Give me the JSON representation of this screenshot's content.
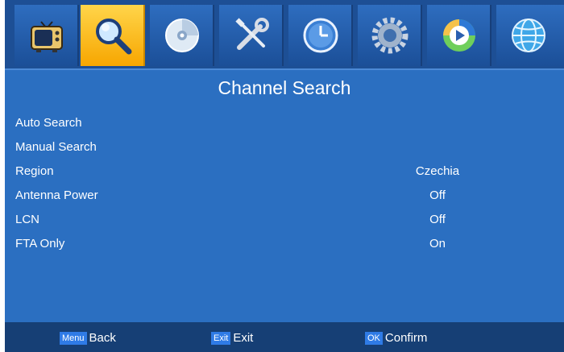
{
  "menu_tabs": [
    {
      "icon": "tv-icon",
      "active": false
    },
    {
      "icon": "search-icon",
      "active": true
    },
    {
      "icon": "disc-icon",
      "active": false
    },
    {
      "icon": "tools-icon",
      "active": false
    },
    {
      "icon": "clock-icon",
      "active": false
    },
    {
      "icon": "gear-icon",
      "active": false
    },
    {
      "icon": "media-player-icon",
      "active": false
    },
    {
      "icon": "globe-icon",
      "active": false
    }
  ],
  "page": {
    "title": "Channel Search"
  },
  "items": [
    {
      "label": "Auto Search",
      "value": ""
    },
    {
      "label": "Manual Search",
      "value": ""
    },
    {
      "label": "Region",
      "value": "Czechia"
    },
    {
      "label": "Antenna Power",
      "value": "Off"
    },
    {
      "label": "LCN",
      "value": "Off"
    },
    {
      "label": "FTA Only",
      "value": "On"
    }
  ],
  "footer": {
    "back_key": "Menu",
    "back_label": "Back",
    "exit_key": "Exit",
    "exit_label": "Exit",
    "ok_key": "OK",
    "ok_label": "Confirm"
  },
  "colors": {
    "background": "#2b6fc1",
    "active_tab": "#f7a600",
    "footer": "#163f75"
  }
}
